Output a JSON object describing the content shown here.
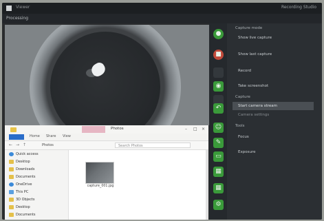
{
  "window": {
    "title": "Viewer",
    "right_title": "Recording Studio",
    "sub_label": "Processing"
  },
  "side_panel": {
    "section1_header": "Capture mode",
    "section1_items": [
      "Show live capture",
      "Show last capture",
      "Record",
      "Take screenshot"
    ],
    "section2_header": "Capture",
    "section2_items": [
      "Start camera stream",
      "Camera settings"
    ],
    "section3_header": "Tools",
    "section3_items": [
      "Focus",
      "Exposure"
    ],
    "icons": [
      "record-icon",
      "stop-icon",
      "camera-icon",
      "undo-icon",
      "user-icon",
      "wrench-icon",
      "chat-icon",
      "grid-icon",
      "grid-icon",
      "settings-icon"
    ],
    "colors": {
      "green": "#3a9a3a",
      "red": "#c24a3b",
      "panel": "#2b2f33"
    }
  },
  "explorer": {
    "tab_label": "Manage",
    "title_label": "Photos",
    "ribbon_tabs": [
      "File",
      "Home",
      "Share",
      "View"
    ],
    "path": "Photos",
    "search_placeholder": "Search Photos",
    "nav_items": [
      {
        "label": "Quick access",
        "icon": "star"
      },
      {
        "label": "Desktop",
        "icon": "folder"
      },
      {
        "label": "Downloads",
        "icon": "folder"
      },
      {
        "label": "Documents",
        "icon": "folder"
      },
      {
        "label": "OneDrive",
        "icon": "cloud"
      },
      {
        "label": "This PC",
        "icon": "pc"
      },
      {
        "label": "3D Objects",
        "icon": "folder"
      },
      {
        "label": "Desktop",
        "icon": "folder"
      },
      {
        "label": "Documents",
        "icon": "folder"
      }
    ],
    "file_item": {
      "label": "capture_001.jpg"
    }
  }
}
